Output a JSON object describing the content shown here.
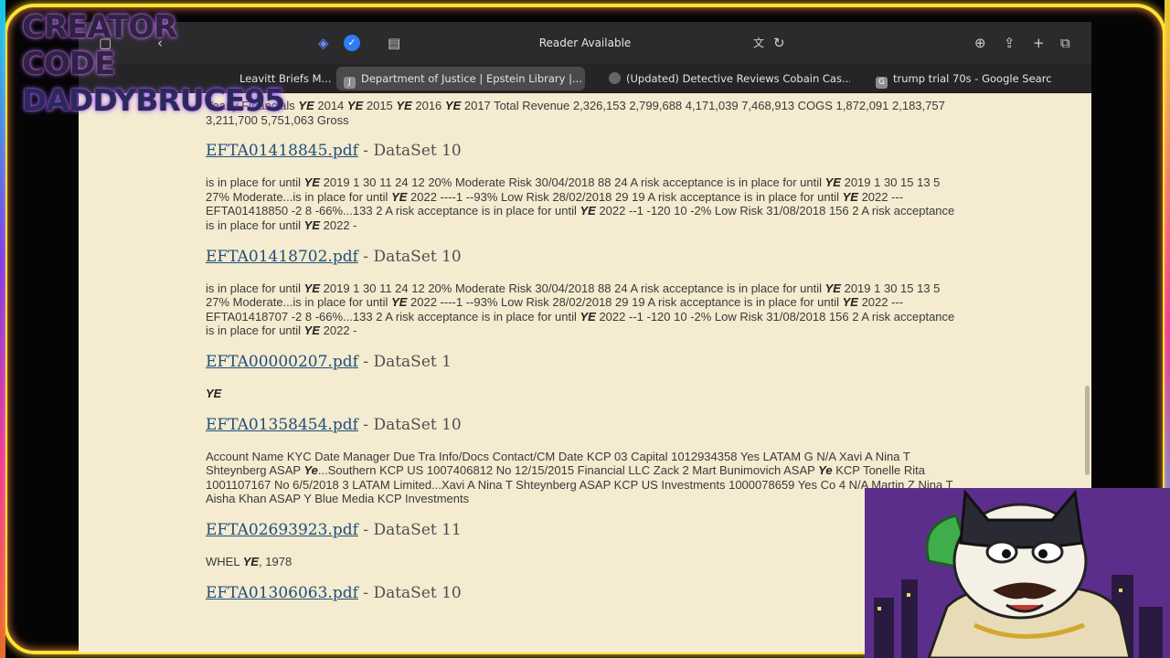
{
  "overlay": {
    "watermark_line1": "CREATOR CODE",
    "watermark_line2": "DADDYBRUCE95"
  },
  "browser": {
    "toolbar": {
      "reader_label": "Reader Available",
      "icons": [
        "sidebar-icon",
        "back-icon",
        "privacy-icon",
        "shield-check-icon",
        "reader-page-icon",
        "translate-icon",
        "reload-icon",
        "download-icon",
        "share-icon",
        "new-tab-icon",
        "tab-overview-icon"
      ]
    },
    "tabs": [
      {
        "label": "Leavitt Briefs M...",
        "favicon": ""
      },
      {
        "label": "Department of Justice | Epstein Library |...",
        "favicon": "J"
      },
      {
        "label": "(Updated) Detective Reviews Cobain Cas...",
        "favicon": ""
      },
      {
        "label": "trump trial 70s - Google Search",
        "favicon": "G"
      }
    ]
  },
  "results": [
    {
      "title": "",
      "dataset": "",
      "snippet": [
        {
          "t": "Yearly Financials "
        },
        {
          "ye": "YE"
        },
        {
          "t": " 2014 "
        },
        {
          "ye": "YE"
        },
        {
          "t": " 2015 "
        },
        {
          "ye": "YE"
        },
        {
          "t": " 2016 "
        },
        {
          "ye": "YE"
        },
        {
          "t": " 2017 Total Revenue 2,326,153 2,799,688 4,171,039 7,468,913 COGS 1,872,091 2,183,757 3,211,700 5,751,063 Gross"
        }
      ]
    },
    {
      "title": "EFTA01418845.pdf",
      "dataset": " - DataSet 10",
      "snippet": [
        {
          "t": "is in place for until "
        },
        {
          "ye": "YE"
        },
        {
          "t": " 2019 1 30 11 24 12 20% Moderate Risk 30/04/2018 88 24 A risk acceptance is in place for until "
        },
        {
          "ye": "YE"
        },
        {
          "t": " 2019 1 30 15 13 5 27% Moderate...is in place for until "
        },
        {
          "ye": "YE"
        },
        {
          "t": " 2022 ----1 --93% Low Risk 28/02/2018 29 19 A risk acceptance is in place for until "
        },
        {
          "ye": "YE"
        },
        {
          "t": " 2022 ---EFTA01418850   -2 8 -66%...133 2 A risk acceptance is in place for until  "
        },
        {
          "ye": "YE"
        },
        {
          "t": " 2022 --1 -120 10 -2% Low Risk 31/08/2018 156 2 A risk acceptance is in place for until "
        },
        {
          "ye": "YE"
        },
        {
          "t": " 2022 -"
        }
      ]
    },
    {
      "title": "EFTA01418702.pdf",
      "dataset": " - DataSet 10",
      "snippet": [
        {
          "t": "is in place for until "
        },
        {
          "ye": "YE"
        },
        {
          "t": " 2019 1 30 11 24 12 20% Moderate Risk 30/04/2018 88 24 A risk acceptance is in place for until "
        },
        {
          "ye": "YE"
        },
        {
          "t": " 2019 1 30 15 13 5 27% Moderate...is in place for until "
        },
        {
          "ye": "YE"
        },
        {
          "t": " 2022 ----1 --93% Low Risk 28/02/2018 29 19 A risk acceptance is in place for until "
        },
        {
          "ye": "YE"
        },
        {
          "t": " 2022 ---EFTA01418707   -2 8 -66%...133 2 A risk acceptance is in place for until  "
        },
        {
          "ye": "YE"
        },
        {
          "t": " 2022 --1 -120 10 -2% Low Risk 31/08/2018 156 2 A risk acceptance is in place for until "
        },
        {
          "ye": "YE"
        },
        {
          "t": " 2022 -"
        }
      ]
    },
    {
      "title": "EFTA00000207.pdf",
      "dataset": " - DataSet 1",
      "snippet": [
        {
          "ye": "YE"
        }
      ]
    },
    {
      "title": "EFTA01358454.pdf",
      "dataset": " - DataSet 10",
      "snippet": [
        {
          "t": "Account Name KYC Date Manager Due Tra Info/Docs Contact/CM Date KCP 03 Capital 1012934358 Yes LATAM G N/A Xavi A Nina T Shteynberg ASAP "
        },
        {
          "ye": "Ye"
        },
        {
          "t": "...Southern KCP US 1007406812 No 12/15/2015 Financial LLC Zack 2 Mart Bunimovich ASAP "
        },
        {
          "ye": "Ye"
        },
        {
          "t": " KCP Tonelle Rita 1001107167 No 6/5/2018 3 LATAM Limited...Xavi A Nina T Shteynberg ASAP KCP US Investments 1000078659 Yes Co 4 N/A Martin Z Nina T Aisha Khan ASAP Y Blue Media KCP Investments"
        }
      ]
    },
    {
      "title": "EFTA02693923.pdf",
      "dataset": " - DataSet 11",
      "snippet": [
        {
          "t": "WHEL "
        },
        {
          "ye": "YE"
        },
        {
          "t": ", 1978"
        }
      ]
    },
    {
      "title": "EFTA01306063.pdf",
      "dataset": " - DataSet 10",
      "snippet": []
    }
  ]
}
